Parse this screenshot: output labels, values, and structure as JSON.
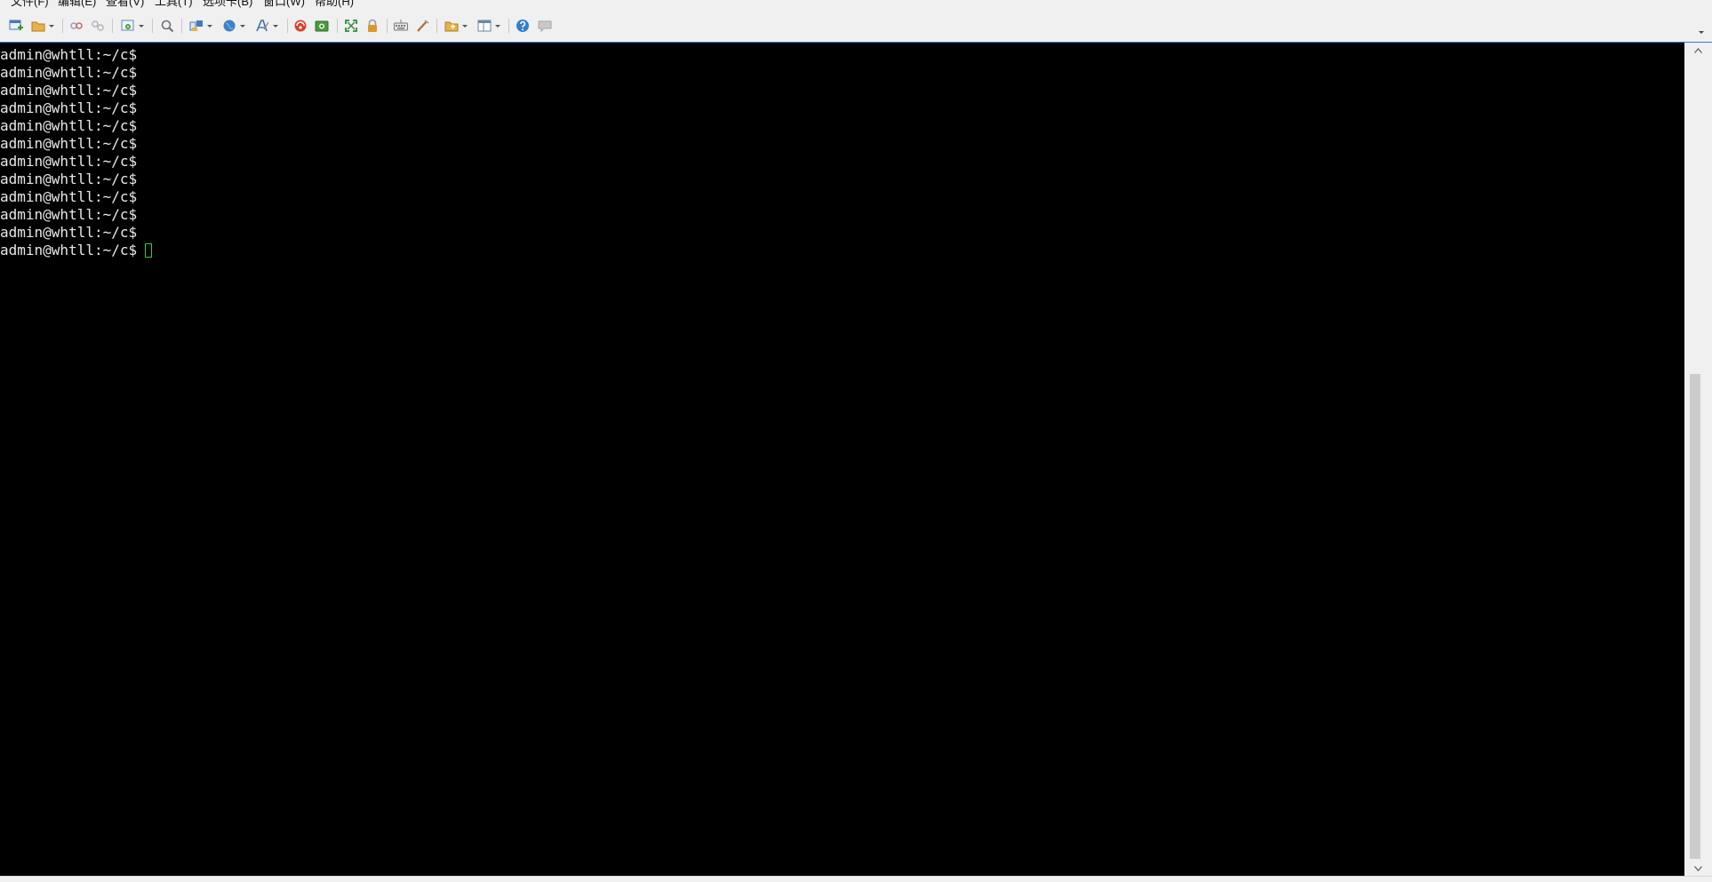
{
  "menubar": {
    "items": [
      {
        "label": "文件(F)"
      },
      {
        "label": "编辑(E)"
      },
      {
        "label": "查看(V)"
      },
      {
        "label": "工具(T)"
      },
      {
        "label": "选项卡(B)"
      },
      {
        "label": "窗口(W)"
      },
      {
        "label": "帮助(H)"
      }
    ]
  },
  "toolbar": {
    "icons": [
      "new-session-icon",
      "open-folder-icon",
      "connect-icon",
      "disconnect-icon",
      "properties-gear-icon",
      "search-icon",
      "transfer-icon",
      "globe-icon",
      "font-icon",
      "xftp-icon",
      "screenshot-icon",
      "fullscreen-icon",
      "lock-icon",
      "keyboard-icon",
      "script-pen-icon",
      "new-tab-folder-icon",
      "layout-icon",
      "help-icon",
      "chat-icon"
    ]
  },
  "terminal": {
    "prompt": "admin@whtll:~/c$",
    "lines": [
      "admin@whtll:~/c$",
      "admin@whtll:~/c$",
      "admin@whtll:~/c$",
      "admin@whtll:~/c$",
      "admin@whtll:~/c$",
      "admin@whtll:~/c$",
      "admin@whtll:~/c$",
      "admin@whtll:~/c$",
      "admin@whtll:~/c$",
      "admin@whtll:~/c$",
      "admin@whtll:~/c$",
      "admin@whtll:~/c$"
    ],
    "text_color": "#e8e8e8",
    "cursor_color": "#2fd22f",
    "background": "#000000"
  },
  "colors": {
    "accent": "#2f7fd0",
    "chrome": "#f0f0f0"
  }
}
